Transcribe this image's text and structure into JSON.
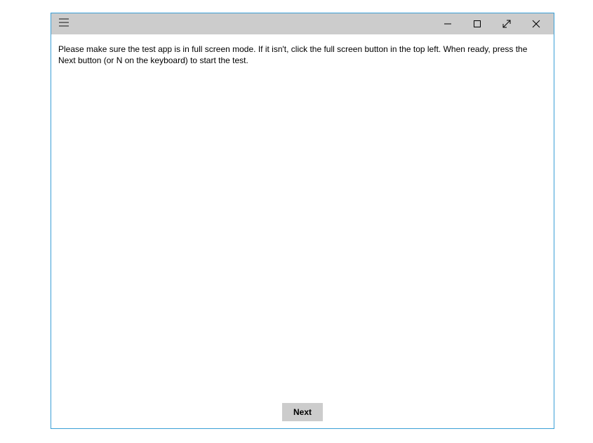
{
  "titlebar": {
    "menu_icon": "hamburger-icon",
    "minimize_icon": "minimize-icon",
    "maximize_icon": "maximize-icon",
    "fullscreen_icon": "fullscreen-icon",
    "close_icon": "close-icon"
  },
  "content": {
    "instructions": "Please make sure the test app is in full screen mode. If it isn't, click the full screen button in the top left. When ready, press the Next button (or N on the keyboard) to start the test."
  },
  "footer": {
    "next_label": "Next"
  }
}
